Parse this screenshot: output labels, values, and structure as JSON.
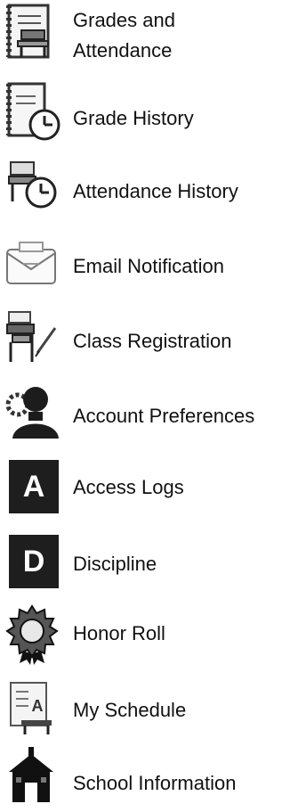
{
  "nav": {
    "items": [
      {
        "label": "Grades and Attendance",
        "icon": "gradebook-icon"
      },
      {
        "label": "Grade History",
        "icon": "grade-history-clock-icon"
      },
      {
        "label": "Attendance History",
        "icon": "attendance-history-clock-icon"
      },
      {
        "label": "Email Notification",
        "icon": "envelope-icon"
      },
      {
        "label": "Class Registration",
        "icon": "desk-registration-icon"
      },
      {
        "label": "Account Preferences",
        "icon": "user-silhouette-icon"
      },
      {
        "label": "Access Logs",
        "icon": "letter-a-badge-icon"
      },
      {
        "label": "Discipline",
        "icon": "letter-d-badge-icon"
      },
      {
        "label": "Honor Roll",
        "icon": "award-seal-icon"
      },
      {
        "label": "My Schedule",
        "icon": "schedule-sheet-icon"
      },
      {
        "label": "School Information",
        "icon": "school-building-icon"
      }
    ]
  }
}
